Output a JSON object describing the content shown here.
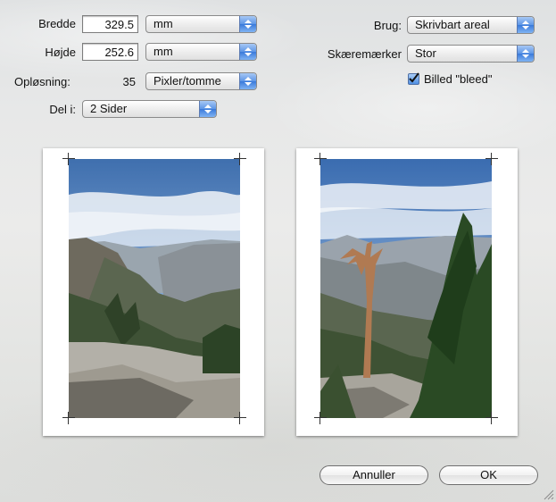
{
  "form": {
    "width_label": "Bredde",
    "width_value": "329.5",
    "width_unit": "mm",
    "height_label": "Højde",
    "height_value": "252.6",
    "height_unit": "mm",
    "resolution_label": "Opløsning:",
    "resolution_value": "35",
    "resolution_unit": "Pixler/tomme",
    "split_label": "Del i:",
    "split_value": "2 Sider",
    "use_label": "Brug:",
    "use_value": "Skrivbart areal",
    "cropmarks_label": "Skæremærker",
    "cropmarks_value": "Stor",
    "bleed_label": "Billed \"bleed\"",
    "bleed_checked": true
  },
  "buttons": {
    "cancel": "Annuller",
    "ok": "OK"
  },
  "colors": {
    "popup_arrow": "#3a7adb",
    "checkbox": "#4f8fe3"
  }
}
